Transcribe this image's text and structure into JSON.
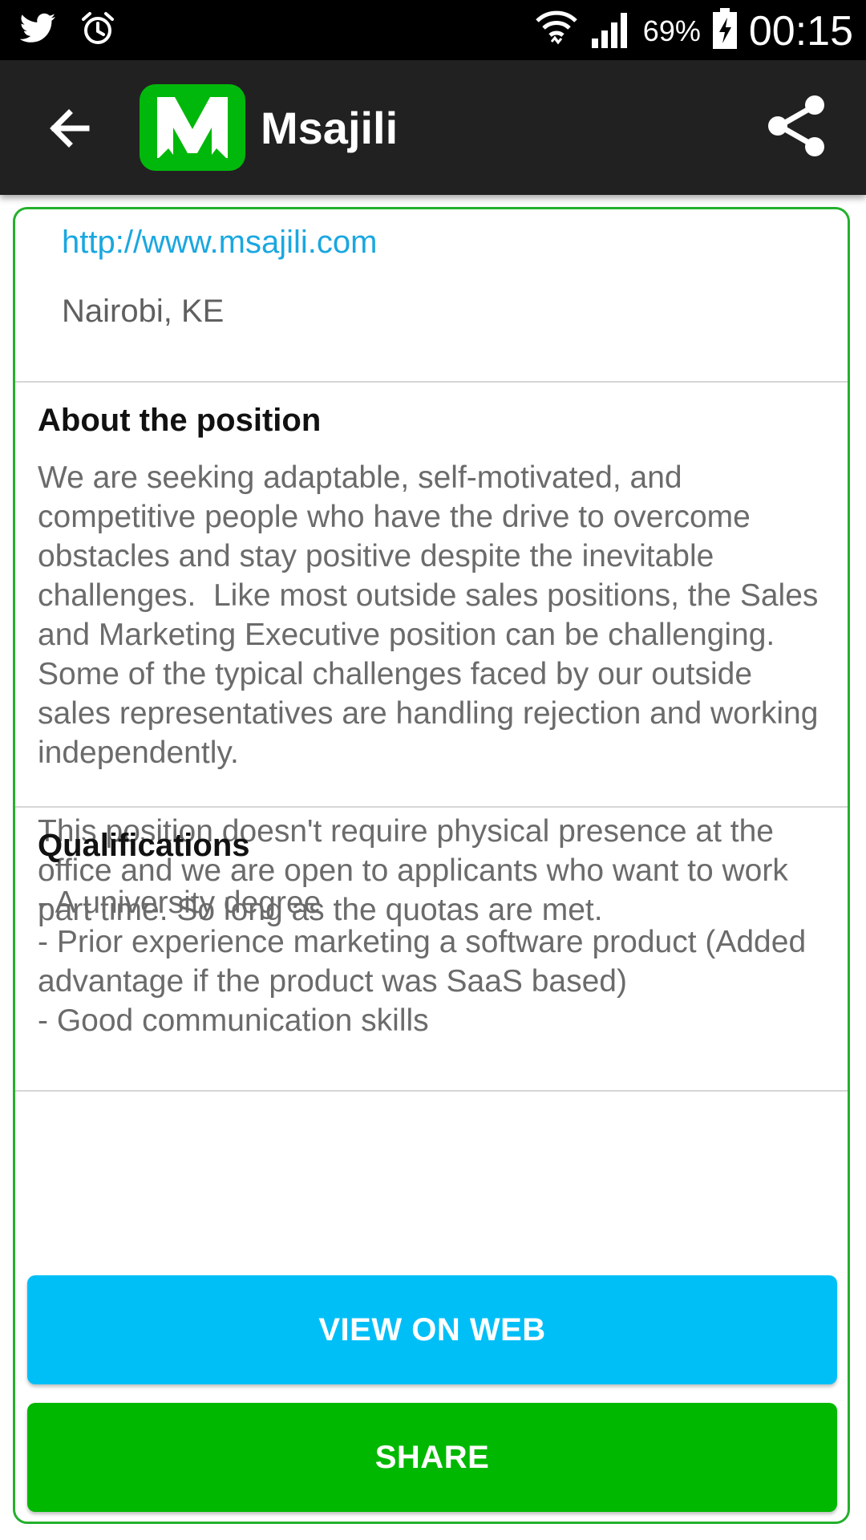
{
  "status_bar": {
    "battery_percent": "69%",
    "time": "00:15",
    "icons": [
      "twitter-icon",
      "alarm-icon",
      "wifi-icon",
      "signal-icon",
      "battery-charging-icon"
    ]
  },
  "app_bar": {
    "title": "Msajili",
    "logo_letter": "M",
    "logo_color": "#00b80b"
  },
  "company": {
    "url": "http://www.msajili.com",
    "location": "Nairobi, KE"
  },
  "about": {
    "title": "About the position",
    "body": "We are seeking adaptable, self-motivated, and competitive people who have the drive to overcome obstacles and stay positive despite the inevitable challenges.  Like most outside sales positions, the Sales and Marketing Executive position can be challenging. Some of the typical challenges faced by our outside sales representatives are handling rejection and working independently.\n\nThis position doesn't require physical presence at the office and we are open to applicants who want to work part time. So long as the quotas are met."
  },
  "qualifications": {
    "title": "Qualifications",
    "body": "- A university degree\n- Prior experience marketing a software product (Added advantage if the product was SaaS based)\n- Good communication skills"
  },
  "buttons": {
    "view_on_web": "VIEW ON WEB",
    "share": "SHARE",
    "view_on_web_color": "#00bff7",
    "share_color": "#00b800"
  },
  "colors": {
    "card_border": "#24b02d",
    "link": "#1aa7e0",
    "app_bar": "#212121"
  }
}
